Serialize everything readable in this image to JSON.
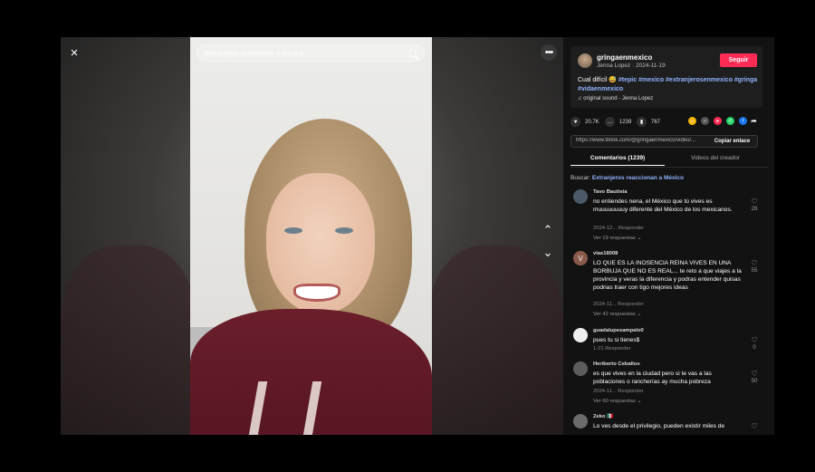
{
  "player": {
    "search_placeholder": "Extranjeros reaccionan a México",
    "close_icon": "×",
    "more_icon": "•••",
    "up_icon": "⌃",
    "down_icon": "⌄"
  },
  "post": {
    "username": "gringaenmexico",
    "author": "Jenna Lopez",
    "date": "2024-11-19",
    "subline": "Jenna Lopez · 2024-11-19",
    "follow_label": "Seguir",
    "caption_text": "Cual difícil 😅 ",
    "hashtags": "#tepic #mexico #extranjerosenmexico #gringa #vidaenmexico",
    "sound": "♫  original sound - Jenna Lopez"
  },
  "stats": {
    "likes": "20.7K",
    "comments": "1239",
    "saves": "767"
  },
  "share": {
    "link": "https://www.tiktok.com/@gringaenmexico/video/...",
    "copy_label": "Copiar enlace"
  },
  "tabs": {
    "comments": "Comentarios (1239)",
    "creator_videos": "Videos del creador"
  },
  "search_related": {
    "label": "Buscar: ",
    "query": "Extranjeros reaccionan a México"
  },
  "comments": [
    {
      "name": "Tavo Bautista",
      "text": "no entiendes nena, el México que tú vives es muuuuuuuuy diferente del México de los mexicanos.",
      "meta": "2024-12...   Responder",
      "replies": "Ver 19 respuestas ⌄",
      "likes": "28",
      "avatar_color": "#4b5a66",
      "initial": ""
    },
    {
      "name": "vlas18008",
      "text": "LO QUE ES LA INOSENCIA REINA VIVES EN UNA BORBUJA QUE NO ES REAL... te reto a que viajes a la provincia y veras la diferencia y podras entender quisas podrias traer con tigo mejores ideas",
      "meta": "2024-11...   Responder",
      "replies": "Ver 42 respuestas ⌄",
      "likes": "55",
      "avatar_color": "#8a5a4a",
      "initial": "V"
    },
    {
      "name": "guadalupesampalo0",
      "text": "pues tu si tienes$",
      "meta": "1-21        Responder",
      "replies": "",
      "likes": "0",
      "avatar_color": "#eeeeee",
      "initial": ""
    },
    {
      "name": "Heriberto Ceballos",
      "text": "es que vives en la ciudad pero si te vas a las poblaciones o rancherías ay mucha pobreza",
      "meta": "2024-11...   Responder",
      "replies": "Ver 60 respuestas ⌄",
      "likes": "50",
      "avatar_color": "#5c5c5c",
      "initial": ""
    },
    {
      "name": "Zeko 🇲🇽",
      "text": "Lo ves desde el privilegio, pueden existir miles de",
      "meta": "",
      "replies": "",
      "likes": "",
      "avatar_color": "#6b6b6b",
      "initial": ""
    }
  ],
  "colors": {
    "accent": "#fe2c55",
    "hashtag": "#8fb3ff",
    "panel_bg": "#121212"
  }
}
